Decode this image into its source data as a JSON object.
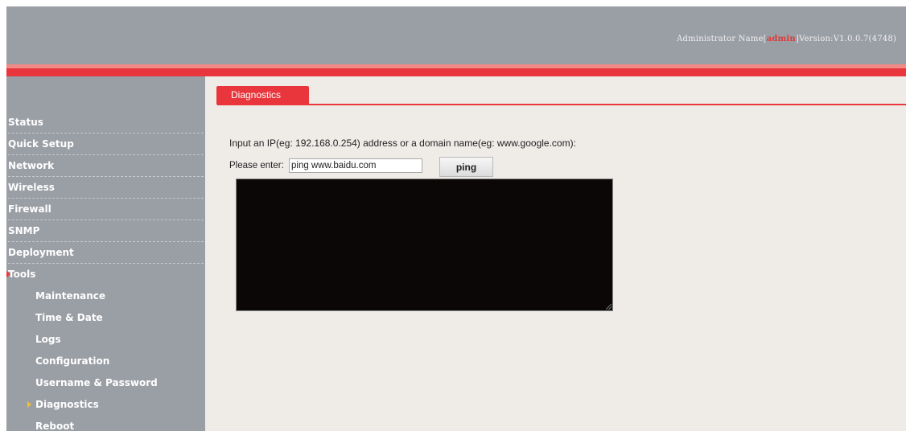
{
  "header": {
    "admin_prefix": "Administrator Name[",
    "admin_name": "admin",
    "version_text": "]Version:V1.0.0.7(4748)"
  },
  "sidebar": {
    "items": [
      {
        "label": "Status"
      },
      {
        "label": "Quick Setup"
      },
      {
        "label": "Network"
      },
      {
        "label": "Wireless"
      },
      {
        "label": "Firewall"
      },
      {
        "label": "SNMP"
      },
      {
        "label": "Deployment"
      },
      {
        "label": "Tools",
        "expanded": true,
        "active": true
      }
    ],
    "subitems": [
      {
        "label": "Maintenance"
      },
      {
        "label": "Time & Date"
      },
      {
        "label": "Logs"
      },
      {
        "label": "Configuration"
      },
      {
        "label": "Username & Password"
      },
      {
        "label": "Diagnostics",
        "active": true
      },
      {
        "label": "Reboot"
      }
    ]
  },
  "main": {
    "tab_label": "Diagnostics",
    "instruction": "Input an IP(eg: 192.168.0.254) address or a domain name(eg: www.google.com):",
    "enter_label": "Please enter:",
    "input_value": "ping www.baidu.com",
    "ping_button": "ping",
    "output_text": ""
  },
  "colors": {
    "accent_red": "#e8363c",
    "sidebar_gray": "#9a9ea5",
    "content_bg": "#efece8",
    "output_bg": "#0b0707",
    "active_arrow": "#f0c030"
  }
}
